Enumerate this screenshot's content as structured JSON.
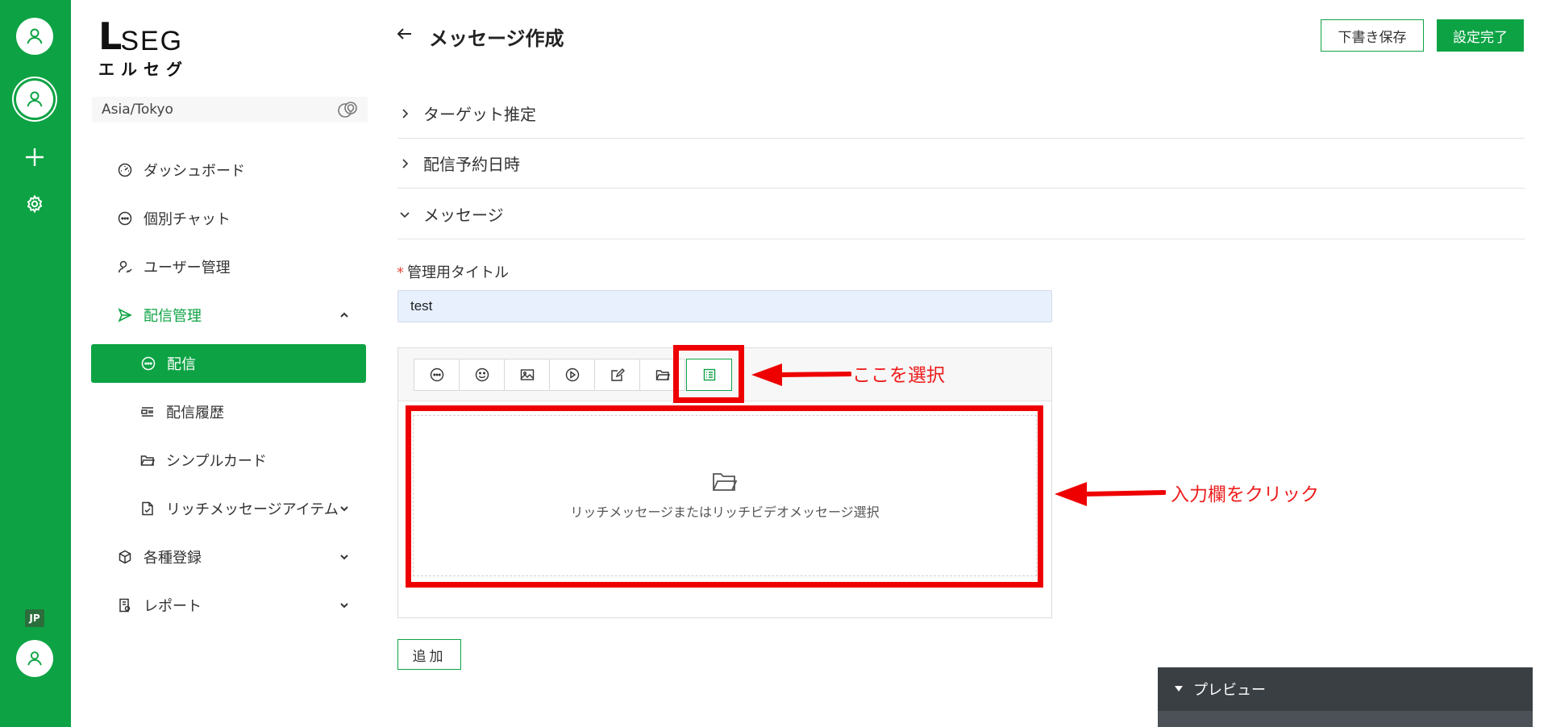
{
  "rail": {
    "language": "JP"
  },
  "logo": {
    "mark": "L",
    "brand": "SEG",
    "brand_jp": "エルセグ"
  },
  "timezone": {
    "value": "Asia/Tokyo"
  },
  "nav": {
    "items": [
      {
        "label": "ダッシュボード",
        "icon": "dashboard-icon"
      },
      {
        "label": "個別チャット",
        "icon": "chat-icon"
      },
      {
        "label": "ユーザー管理",
        "icon": "users-icon"
      },
      {
        "label": "配信管理",
        "icon": "send-icon"
      },
      {
        "label": "配信",
        "icon": "chat-icon"
      },
      {
        "label": "配信履歴",
        "icon": "history-icon"
      },
      {
        "label": "シンプルカード",
        "icon": "folder-icon"
      },
      {
        "label": "リッチメッセージアイテム",
        "icon": "document-icon"
      },
      {
        "label": "各種登録",
        "icon": "cube-icon"
      },
      {
        "label": "レポート",
        "icon": "report-icon"
      }
    ]
  },
  "header": {
    "title": "メッセージ作成",
    "draft_save": "下書き保存",
    "complete": "設定完了"
  },
  "sections": [
    {
      "label": "ターゲット推定",
      "expanded": false
    },
    {
      "label": "配信予約日時",
      "expanded": false
    },
    {
      "label": "メッセージ",
      "expanded": true
    }
  ],
  "form": {
    "title_label": "管理用タイトル",
    "required_mark": "*",
    "title_value": "test"
  },
  "editor": {
    "toolbar": [
      "text-icon",
      "sticker-icon",
      "image-icon",
      "video-icon",
      "edit-icon",
      "folder-icon",
      "rich-message-icon"
    ],
    "drop_zone_text": "リッチメッセージまたはリッチビデオメッセージ選択"
  },
  "add_button": "追加",
  "annotations": {
    "select_here": "ここを選択",
    "click_input": "入力欄をクリック",
    "color": "#ee0000"
  },
  "preview": {
    "label": "プレビュー"
  },
  "colors": {
    "brand_green": "#0da344",
    "preview_dark": "#3a3f44"
  }
}
